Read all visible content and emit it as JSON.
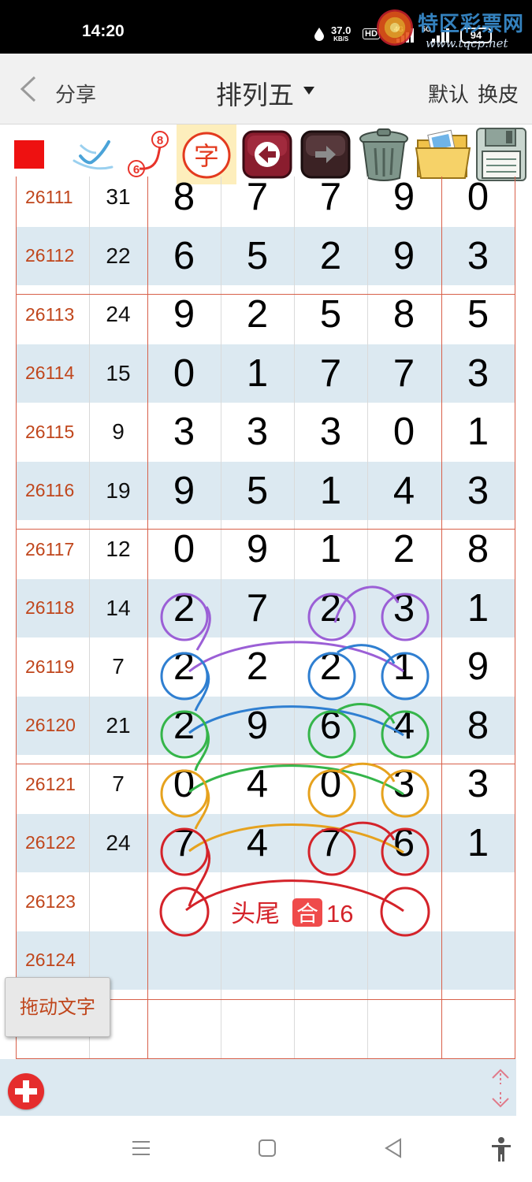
{
  "status_bar": {
    "time": "14:20",
    "net_speed_value": "37.0",
    "net_speed_unit": "KB/S",
    "hd_label": "HD",
    "sim1_label": "4G",
    "sim2_label": "5G",
    "battery": "94",
    "watermark_text": "特区彩票网",
    "watermark_url": "www.tqcp.net"
  },
  "nav": {
    "share_label": "分享",
    "title": "排列五",
    "default_label": "默认",
    "skin_label": "换皮"
  },
  "toolbar": {
    "tools": [
      "red-square",
      "check-pen",
      "curve-6-8",
      "text-zi",
      "undo-arrow",
      "redo-arrow",
      "trash",
      "picture-folder",
      "save-disk"
    ],
    "curve_from": "6",
    "curve_to": "8",
    "text_tool_label": "字",
    "active_tool": "text-zi"
  },
  "grid": {
    "rows": [
      {
        "issue": "26111",
        "sum": "31",
        "digits": [
          "8",
          "7",
          "7",
          "9",
          "0"
        ]
      },
      {
        "issue": "26112",
        "sum": "22",
        "digits": [
          "6",
          "5",
          "2",
          "9",
          "3"
        ]
      },
      {
        "issue": "26113",
        "sum": "24",
        "digits": [
          "9",
          "2",
          "5",
          "8",
          "5"
        ]
      },
      {
        "issue": "26114",
        "sum": "15",
        "digits": [
          "0",
          "1",
          "7",
          "7",
          "3"
        ]
      },
      {
        "issue": "26115",
        "sum": "9",
        "digits": [
          "3",
          "3",
          "3",
          "0",
          "1"
        ]
      },
      {
        "issue": "26116",
        "sum": "19",
        "digits": [
          "9",
          "5",
          "1",
          "4",
          "3"
        ]
      },
      {
        "issue": "26117",
        "sum": "12",
        "digits": [
          "0",
          "9",
          "1",
          "2",
          "8"
        ]
      },
      {
        "issue": "26118",
        "sum": "14",
        "digits": [
          "2",
          "7",
          "2",
          "3",
          "1"
        ]
      },
      {
        "issue": "26119",
        "sum": "7",
        "digits": [
          "2",
          "2",
          "2",
          "1",
          "9"
        ]
      },
      {
        "issue": "26120",
        "sum": "21",
        "digits": [
          "2",
          "9",
          "6",
          "4",
          "8"
        ]
      },
      {
        "issue": "26121",
        "sum": "7",
        "digits": [
          "0",
          "4",
          "0",
          "3",
          "3"
        ]
      },
      {
        "issue": "26122",
        "sum": "24",
        "digits": [
          "7",
          "4",
          "7",
          "6",
          "1"
        ]
      },
      {
        "issue": "26123",
        "sum": "",
        "digits": [
          "",
          "",
          "",
          "",
          ""
        ]
      },
      {
        "issue": "26124",
        "sum": "",
        "digits": [
          "",
          "",
          "",
          "",
          ""
        ]
      },
      {
        "issue": "",
        "sum": "",
        "digits": [
          "",
          "",
          "",
          "",
          ""
        ]
      }
    ],
    "annotation_text_part1": "头尾",
    "annotation_badge": "合",
    "annotation_text_part2": "16",
    "colors": {
      "issue_text": "#c0461c",
      "row_shade": "#dce9f1",
      "group_line": "#d8604a",
      "purple": "#9b5fd6",
      "blue": "#2f7fd1",
      "green": "#35b54a",
      "orange": "#e6a21e",
      "red": "#d4232a"
    }
  },
  "drag_text_button": "拖动文字",
  "footer": {
    "add_icon": "plus-circle-icon",
    "resize_icon": "resize-vertical-icon"
  },
  "system_nav": [
    "menu-icon",
    "home-icon",
    "back-icon",
    "accessibility-icon"
  ]
}
